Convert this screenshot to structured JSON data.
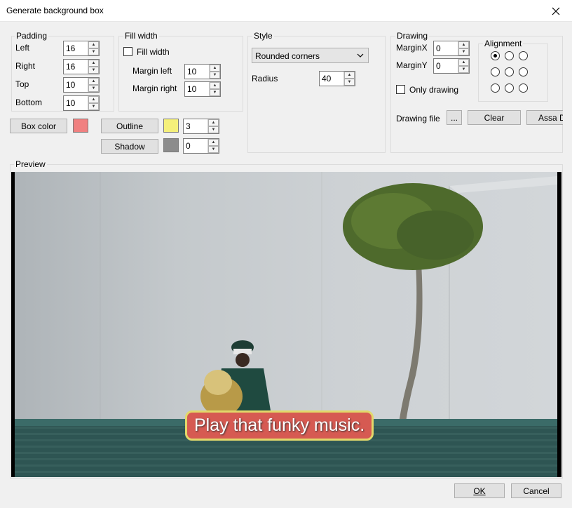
{
  "window": {
    "title": "Generate background box"
  },
  "padding": {
    "legend": "Padding",
    "left_label": "Left",
    "left_value": "16",
    "right_label": "Right",
    "right_value": "16",
    "top_label": "Top",
    "top_value": "10",
    "bottom_label": "Bottom",
    "bottom_value": "10"
  },
  "fill_width": {
    "legend": "Fill width",
    "checkbox_label": "Fill width",
    "checked": false,
    "margin_left_label": "Margin left",
    "margin_left_value": "10",
    "margin_right_label": "Margin right",
    "margin_right_value": "10"
  },
  "style": {
    "legend": "Style",
    "selected": "Rounded corners",
    "radius_label": "Radius",
    "radius_value": "40"
  },
  "drawing": {
    "legend": "Drawing",
    "marginx_label": "MarginX",
    "marginx_value": "0",
    "marginy_label": "MarginY",
    "marginy_value": "0",
    "only_drawing_label": "Only drawing",
    "only_drawing_checked": false,
    "alignment_legend": "Alignment",
    "alignment_selected": "top-left",
    "drawing_file_label": "Drawing file",
    "browse_label": "...",
    "clear_label": "Clear",
    "assa_label": "Assa D"
  },
  "colors": {
    "box_color_label": "Box color",
    "box_color": "#f08080",
    "outline_label": "Outline",
    "outline_color": "#f5f07a",
    "outline_value": "3",
    "shadow_label": "Shadow",
    "shadow_color": "#8c8c8c",
    "shadow_value": "0"
  },
  "preview": {
    "legend": "Preview",
    "subtitle_text": "Play that funky music."
  },
  "footer": {
    "ok_label": "OK",
    "cancel_label": "Cancel"
  }
}
